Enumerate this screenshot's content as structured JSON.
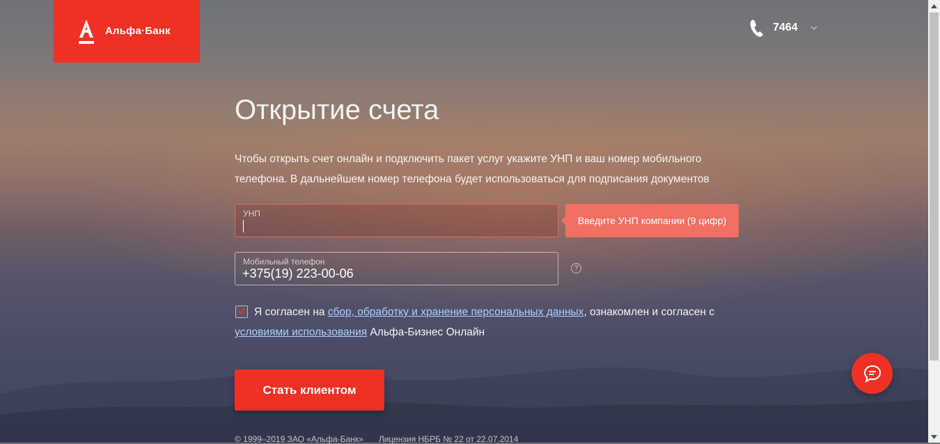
{
  "logo": {
    "text": "Альфа·Банк"
  },
  "header": {
    "phone_number": "7464"
  },
  "page": {
    "title": "Открытие счета",
    "description": "Чтобы открыть счет онлайн и подключить пакет услуг укажите УНП и ваш номер мобильного телефона. В дальнейшем номер телефона будет использоваться для подписания документов"
  },
  "form": {
    "unp": {
      "label": "УНП",
      "value": "",
      "tooltip": "Введите УНП компании (9 цифр)"
    },
    "phone": {
      "label": "Мобильный телефон",
      "value": "+375(19) 223-00-06"
    },
    "help_symbol": "?",
    "consent": {
      "checked": true,
      "text_1": "Я согласен на ",
      "link_1": "сбор, обработку и хранение персональных данных",
      "text_2": ", ознакомлен и согласен с ",
      "link_2": "условиями использования",
      "text_3": " Альфа-Бизнес Онлайн"
    },
    "submit_label": "Стать клиентом"
  },
  "footer": {
    "copyright": "© 1999–2019 ЗАО «Альфа-Банк»",
    "license": "Лицензия НБРБ № 22 от 22.07.2014"
  },
  "icons": {
    "phone": "phone-icon",
    "chevron": "chevron-down-icon",
    "check": "checkmark-icon",
    "chat": "chat-bubble-icon",
    "logo": "alfa-logo-icon"
  },
  "colors": {
    "brand": "#ef3124",
    "tooltip": "#f26f64",
    "link": "#a8d2ff"
  }
}
